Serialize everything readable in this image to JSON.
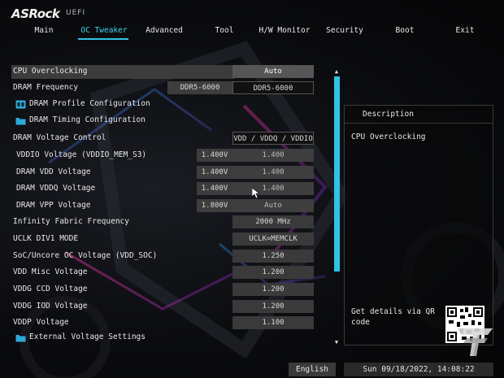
{
  "header": {
    "brand": "ASRock",
    "subtitle": "UEFI"
  },
  "tabs": [
    {
      "label": "Main"
    },
    {
      "label": "OC Tweaker"
    },
    {
      "label": "Advanced"
    },
    {
      "label": "Tool"
    },
    {
      "label": "H/W Monitor"
    },
    {
      "label": "Security"
    },
    {
      "label": "Boot"
    },
    {
      "label": "Exit"
    }
  ],
  "active_tab": "OC Tweaker",
  "settings": [
    {
      "label": "CPU Overclocking",
      "value": "Auto"
    },
    {
      "label": "DRAM Frequency",
      "current": "DDR5-6000",
      "value": "DDR5-6000"
    },
    {
      "label": "DRAM Profile Configuration"
    },
    {
      "label": "DRAM Timing Configuration"
    },
    {
      "label": "DRAM Voltage Control",
      "value": "VDD / VDDQ / VDDIO"
    },
    {
      "label": "VDDIO Voltage (VDDIO_MEM_S3)",
      "current": "1.400V",
      "value": "1.400"
    },
    {
      "label": "DRAM VDD Voltage",
      "current": "1.400V",
      "value": "1.400"
    },
    {
      "label": "DRAM VDDQ Voltage",
      "current": "1.400V",
      "value": "1.400"
    },
    {
      "label": "DRAM VPP Voltage",
      "current": "1.800V",
      "value": "Auto"
    },
    {
      "label": "Infinity Fabric Frequency",
      "value": "2000 MHz"
    },
    {
      "label": "UCLK DIV1 MODE",
      "value": "UCLK=MEMCLK"
    },
    {
      "label": "SoC/Uncore OC Voltage (VDD_SOC)",
      "value": "1.250"
    },
    {
      "label": "VDD Misc Voltage",
      "value": "1.200"
    },
    {
      "label": "VDDG CCD Voltage",
      "value": "1.200"
    },
    {
      "label": "VDDG IOD Voltage",
      "value": "1.200"
    },
    {
      "label": "VDDP Voltage",
      "value": "1.100"
    },
    {
      "label": "External Voltage Settings"
    }
  ],
  "description": {
    "title": "Description",
    "text": "CPU Overclocking",
    "qr_text": "Get details via QR code"
  },
  "footer": {
    "language": "English",
    "datetime": "Sun 09/18/2022, 14:08:22"
  },
  "colors": {
    "accent": "#2fc3e6",
    "highlight_row": "#3c3c3c"
  }
}
